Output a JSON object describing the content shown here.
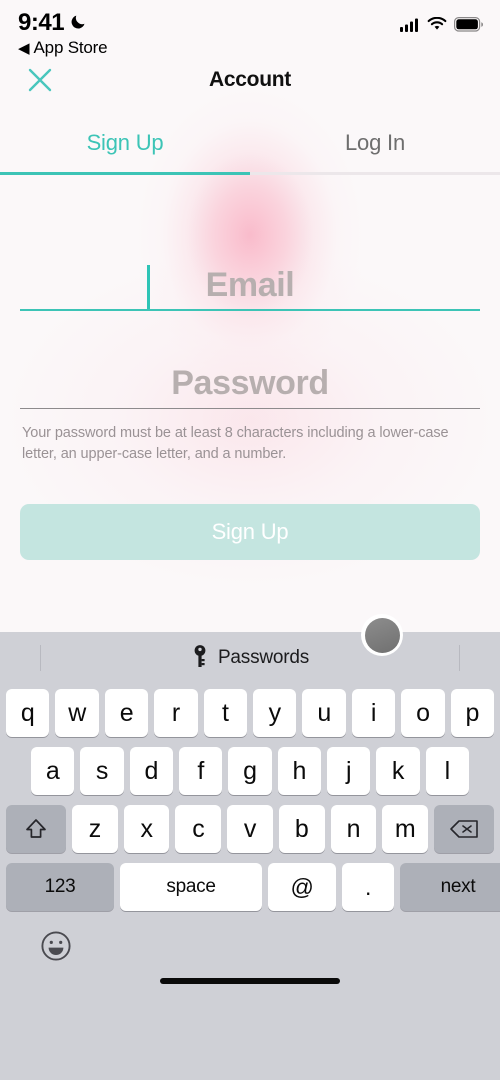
{
  "status_bar": {
    "time": "9:41",
    "dnd_icon": "moon-icon",
    "back_caret": "◀",
    "back_label": "App Store",
    "signal_icon": "cellular-signal-icon",
    "wifi_icon": "wifi-icon",
    "battery_icon": "battery-full-icon"
  },
  "header": {
    "close_icon": "close-x-icon",
    "title": "Account"
  },
  "tabs": {
    "items": [
      {
        "label": "Sign Up",
        "active": true
      },
      {
        "label": "Log In",
        "active": false
      }
    ],
    "active_color": "#3cc4b6",
    "inactive_color": "#6e6e6e"
  },
  "form": {
    "email": {
      "placeholder": "Email",
      "value": "",
      "focused": true,
      "underline_color": "#3cc4b6"
    },
    "password": {
      "placeholder": "Password",
      "value": "",
      "focused": false,
      "underline_color": "#8d8a8c"
    },
    "hint": "Your password must be at least 8 characters including a lower-case letter, an upper-case letter, and a number.",
    "submit_label": "Sign Up",
    "submit_enabled": false,
    "submit_bg": "#c4e5e0",
    "submit_text_color": "#ffffff"
  },
  "keyboard": {
    "quicktype": {
      "key_icon": "key-icon",
      "label": "Passwords"
    },
    "row1": [
      "q",
      "w",
      "e",
      "r",
      "t",
      "y",
      "u",
      "i",
      "o",
      "p"
    ],
    "row2": [
      "a",
      "s",
      "d",
      "f",
      "g",
      "h",
      "j",
      "k",
      "l"
    ],
    "row3_letters": [
      "z",
      "x",
      "c",
      "v",
      "b",
      "n",
      "m"
    ],
    "shift_icon": "shift-arrow-icon",
    "backspace_icon": "backspace-delete-icon",
    "row4": {
      "numbers_label": "123",
      "space_label": "space",
      "at_label": "@",
      "dot_label": ".",
      "return_label": "next"
    },
    "emoji_icon": "emoji-smiley-icon",
    "background": "#cfd0d6"
  },
  "overlay": {
    "cursor_indicator": "touch-cursor-dot"
  }
}
